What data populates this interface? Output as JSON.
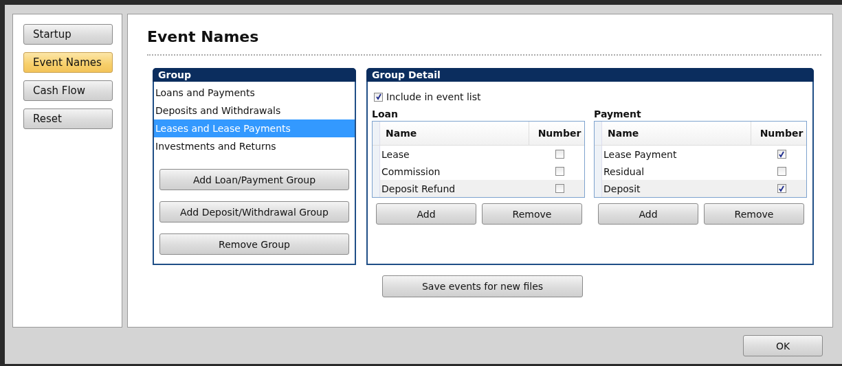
{
  "sidebar": {
    "items": [
      {
        "label": "Startup",
        "selected": false
      },
      {
        "label": "Event Names",
        "selected": true
      },
      {
        "label": "Cash Flow",
        "selected": false
      },
      {
        "label": "Reset",
        "selected": false
      }
    ]
  },
  "page_title": "Event Names",
  "group_panel": {
    "title": "Group",
    "items": [
      {
        "label": "Loans and Payments",
        "selected": false
      },
      {
        "label": "Deposits and Withdrawals",
        "selected": false
      },
      {
        "label": "Leases and Lease Payments",
        "selected": true
      },
      {
        "label": "Investments and Returns",
        "selected": false
      }
    ],
    "buttons": [
      "Add Loan/Payment Group",
      "Add Deposit/Withdrawal Group",
      "Remove Group"
    ]
  },
  "detail_panel": {
    "title": "Group Detail",
    "include": {
      "label": "Include in event list",
      "checked": true
    },
    "grids": [
      {
        "title": "Loan",
        "columns": [
          "Name",
          "Number"
        ],
        "rows": [
          {
            "name": "Lease",
            "number": false
          },
          {
            "name": "Commission",
            "number": false
          },
          {
            "name": "Deposit Refund",
            "number": false
          }
        ],
        "buttons": [
          "Add",
          "Remove"
        ]
      },
      {
        "title": "Payment",
        "columns": [
          "Name",
          "Number"
        ],
        "rows": [
          {
            "name": "Lease Payment",
            "number": true
          },
          {
            "name": "Residual",
            "number": false
          },
          {
            "name": "Deposit",
            "number": true
          }
        ],
        "buttons": [
          "Add",
          "Remove"
        ]
      }
    ]
  },
  "save_button": "Save events for new files",
  "ok_button": "OK"
}
